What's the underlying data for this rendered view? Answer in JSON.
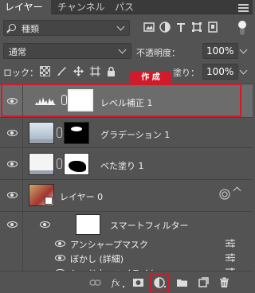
{
  "tabs": [
    {
      "label": "レイヤー",
      "active": true
    },
    {
      "label": "チャンネル",
      "active": false
    },
    {
      "label": "パス",
      "active": false
    }
  ],
  "filter": {
    "kind_label": "種類"
  },
  "blend": {
    "mode": "通常",
    "opacity_label": "不透明度：",
    "opacity_value": "100%"
  },
  "lock": {
    "label": "ロック：",
    "fill_label": "塗り：",
    "fill_value": "100%"
  },
  "annotation": {
    "label": "作 成",
    "color": "#d11a2a"
  },
  "layers": [
    {
      "name": "レベル補正 1",
      "selected": true
    },
    {
      "name": "グラデーション 1"
    },
    {
      "name": "べた塗り 1"
    },
    {
      "name": "レイヤー 0"
    },
    {
      "name": "スマートフィルター"
    },
    {
      "name": "アンシャープマスク"
    },
    {
      "name": "ぼかし (詳細)"
    },
    {
      "name": "シャドウ・ハイライト"
    }
  ],
  "footer_icons": [
    "link-icon",
    "fx-icon",
    "mask-icon",
    "adjustment-icon",
    "folder-icon",
    "new-layer-icon",
    "trash-icon"
  ]
}
